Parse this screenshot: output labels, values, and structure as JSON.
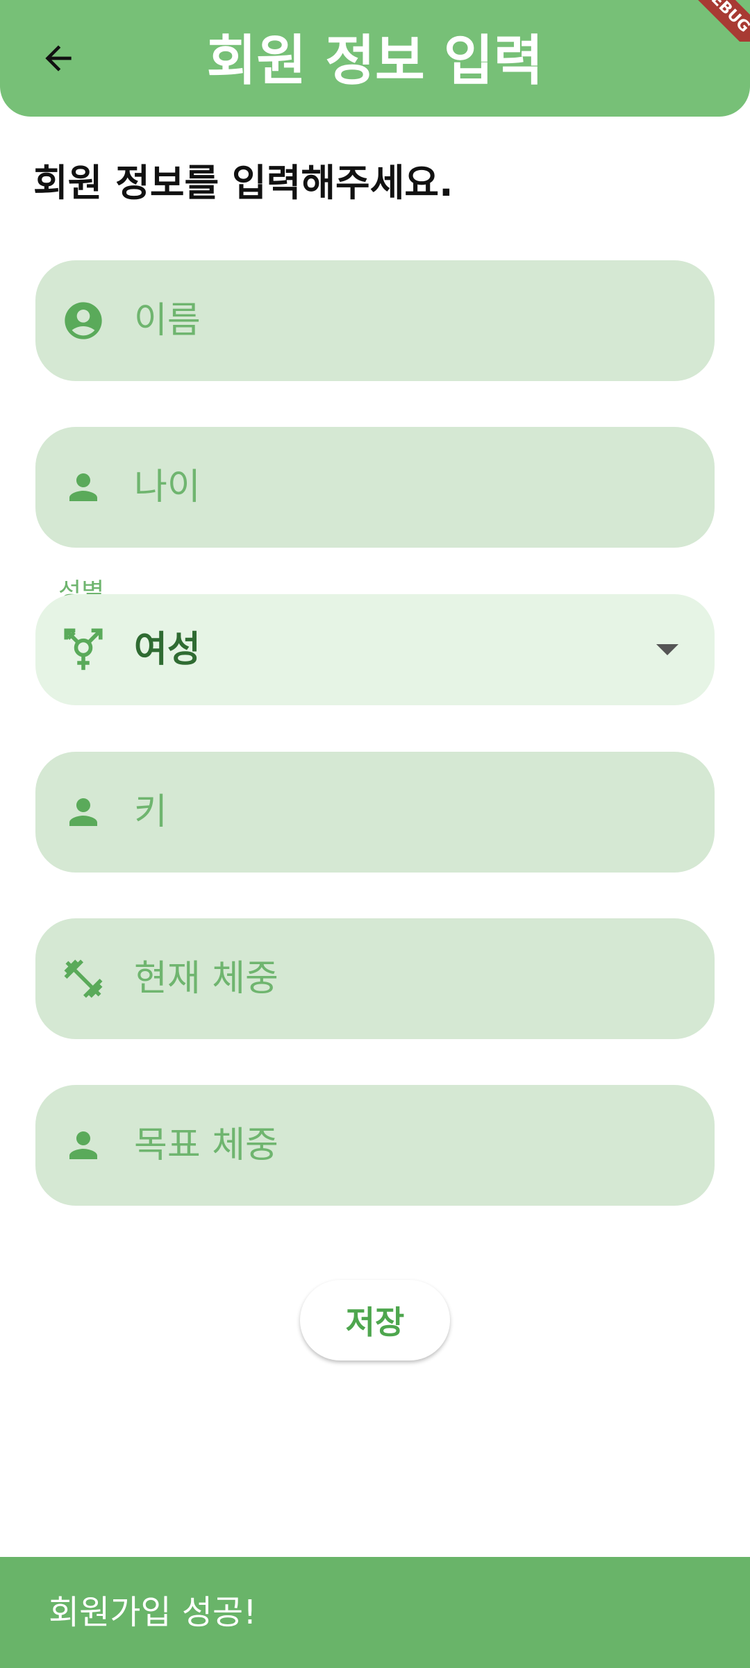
{
  "appbar": {
    "title": "회원 정보 입력",
    "back_icon": "arrow-left-icon",
    "debug_banner": "DEBUG"
  },
  "form": {
    "heading": "회원 정보를 입력해주세요.",
    "name_field": {
      "placeholder": "이름",
      "icon": "account-circle-icon"
    },
    "age_field": {
      "placeholder": "나이",
      "icon": "person-icon"
    },
    "gender_field": {
      "label": "성별",
      "value": "여성",
      "icon": "transgender-icon"
    },
    "height_field": {
      "placeholder": "키",
      "icon": "person-icon"
    },
    "current_weight_field": {
      "placeholder": "현재 체중",
      "icon": "fitness-center-icon"
    },
    "target_weight_field": {
      "placeholder": "목표 체중",
      "icon": "person-icon"
    },
    "save_label": "저장"
  },
  "snackbar": {
    "message": "회원가입 성공!"
  },
  "colors": {
    "primary": "#77c077",
    "field_fill": "#d5e8d3",
    "dropdown_fill": "#e6f4e5",
    "accent_text": "#6fb56f",
    "snackbar": "#69b469"
  }
}
